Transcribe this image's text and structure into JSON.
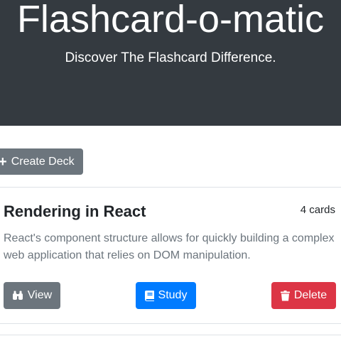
{
  "header": {
    "title": "Flashcard-o-matic",
    "subtitle": "Discover The Flashcard Difference."
  },
  "toolbar": {
    "create_deck_label": "Create Deck",
    "create_deck_icon": "plus-icon"
  },
  "decks": [
    {
      "name": "Rendering in React",
      "card_count": "4 cards",
      "description": "React's component structure allows for quickly building a complex web application that relies on DOM manipulation.",
      "actions": {
        "view_label": "View",
        "view_icon": "binoculars-icon",
        "study_label": "Study",
        "study_icon": "book-icon",
        "delete_label": "Delete",
        "delete_icon": "trash-icon"
      }
    }
  ],
  "colors": {
    "header_bg": "#343a40",
    "secondary": "#6c757d",
    "primary": "#007bff",
    "danger": "#dc3545"
  }
}
